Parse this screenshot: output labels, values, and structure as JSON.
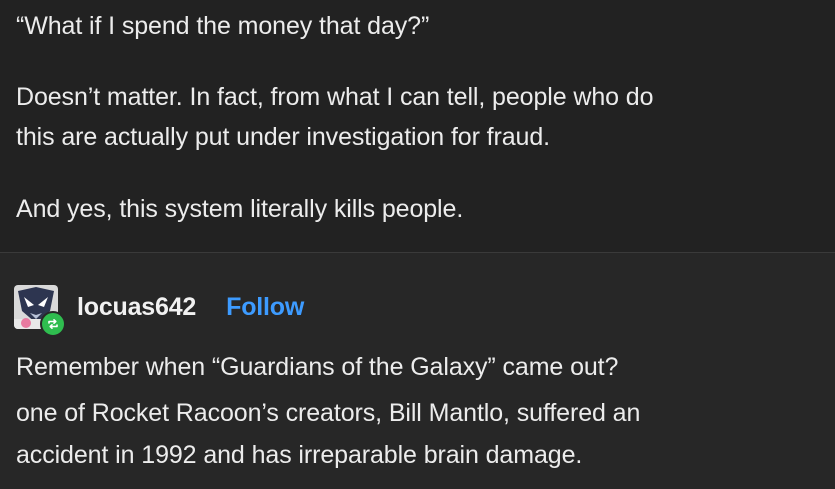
{
  "post": {
    "paragraphs": [
      "“What if I spend the money that day?”",
      "Doesn’t matter. In fact, from what I can tell, people who do",
      "this are actually put under investigation for fraud.",
      "And yes, this system literally kills people."
    ]
  },
  "reply": {
    "username": "locuas642",
    "follow_label": "Follow",
    "reblog_icon": "reblog-icon",
    "lines": [
      "Remember when “Guardians of the Galaxy” came out?",
      "one of Rocket Racoon’s creators, Bill Mantlo, suffered an",
      "accident in 1992 and has irreparable brain damage."
    ]
  },
  "colors": {
    "background": "#222222",
    "reply_background": "#272727",
    "text": "#ececec",
    "follow_link": "#3d9bff",
    "reblog_badge": "#2fbd4f"
  }
}
